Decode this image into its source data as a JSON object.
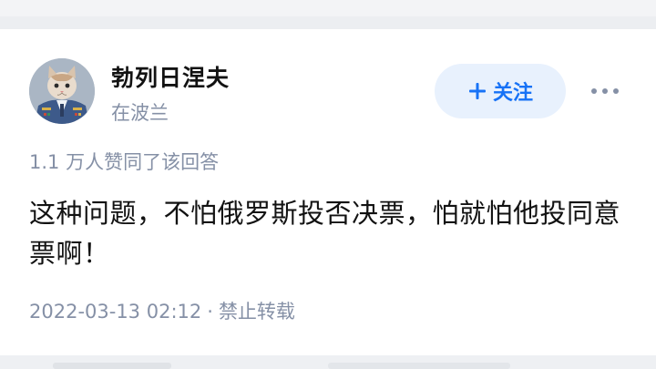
{
  "author": {
    "name": "勃列日涅夫",
    "location": "在波兰",
    "avatar_icon": "cat-in-uniform-avatar"
  },
  "follow": {
    "label": "关注",
    "icon": "plus-icon",
    "bg_color": "#e8f1fd",
    "text_color": "#1772f6"
  },
  "more_icon": "ellipsis-icon",
  "answer": {
    "likes_text": "1.1 万人赞同了该回答",
    "body": "这种问题，不怕俄罗斯投否决票，怕就怕他投同意票啊！",
    "timestamp": "2022-03-13 02:12",
    "separator": "·",
    "copyright": "禁止转载"
  }
}
